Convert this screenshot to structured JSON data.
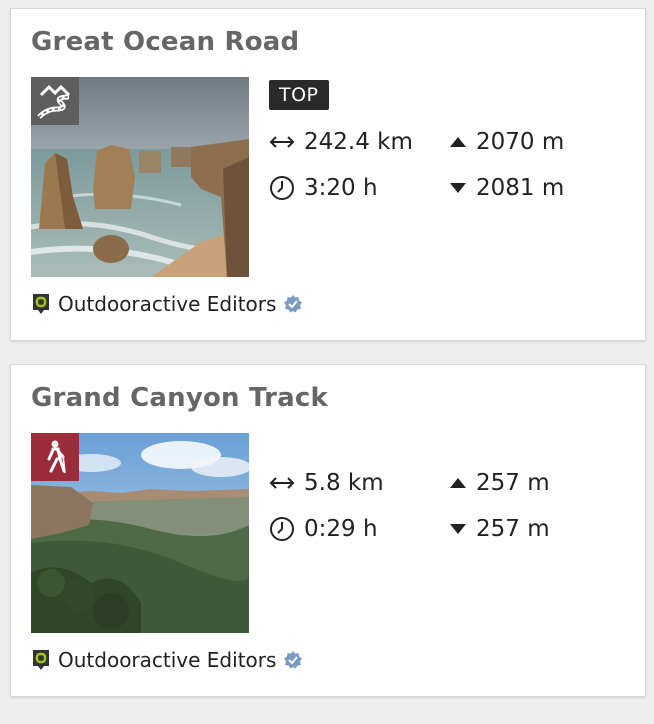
{
  "tours": [
    {
      "title": "Great Ocean Road",
      "category_icon": "coastal-road-icon",
      "category_color": "#5e5e5e",
      "badge": "TOP",
      "distance": "242.4 km",
      "duration": "3:20 h",
      "ascent": "2070 m",
      "descent": "2081 m",
      "author": "Outdooractive Editors"
    },
    {
      "title": "Grand Canyon Track",
      "category_icon": "hiking-icon",
      "category_color": "#9b2d3a",
      "distance": "5.8 km",
      "duration": "0:29 h",
      "ascent": "257 m",
      "descent": "257 m",
      "author": "Outdooractive Editors"
    }
  ],
  "colors": {
    "background": "#ededed",
    "card": "#ffffff",
    "title": "#666666",
    "badge": "#2a2a2a",
    "logo": "#a0c514",
    "verified": "#7a9cc0"
  }
}
